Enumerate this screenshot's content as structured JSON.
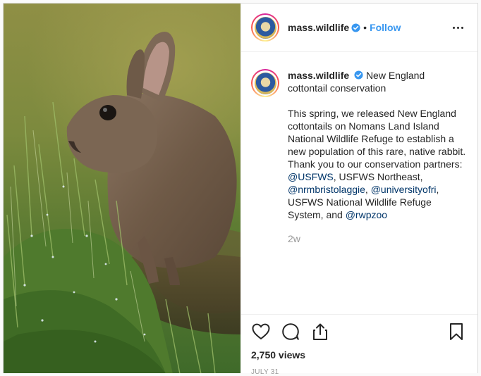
{
  "post": {
    "username": "mass.wildlife",
    "follow_label": "Follow",
    "dot": "•",
    "caption_title": "New England cottontail conservation",
    "caption_segments": [
      {
        "text": "This spring, we released New England cottontails on Nomans Land Island National Wildlife Refuge to establish a new population of this rare, native rabbit. Thank you to our conservation partners: ",
        "mention": false
      },
      {
        "text": "@USFWS",
        "mention": true
      },
      {
        "text": ", USFWS Northeast, ",
        "mention": false
      },
      {
        "text": "@nrmbristolaggie",
        "mention": true
      },
      {
        "text": ", ",
        "mention": false
      },
      {
        "text": "@universityofri",
        "mention": true
      },
      {
        "text": ", USFWS National Wildlife Refuge System, and ",
        "mention": false
      },
      {
        "text": "@rwpzoo",
        "mention": true
      }
    ],
    "time_ago": "2w",
    "views": "2,750 views",
    "date": "July 31"
  },
  "icons": {
    "like": "heart-icon",
    "comment": "comment-icon",
    "share": "share-icon",
    "save": "bookmark-icon",
    "more": "more-options-icon",
    "verified": "verified-badge-icon"
  },
  "colors": {
    "link": "#3897f0",
    "mention": "#003569",
    "muted": "#999999"
  }
}
